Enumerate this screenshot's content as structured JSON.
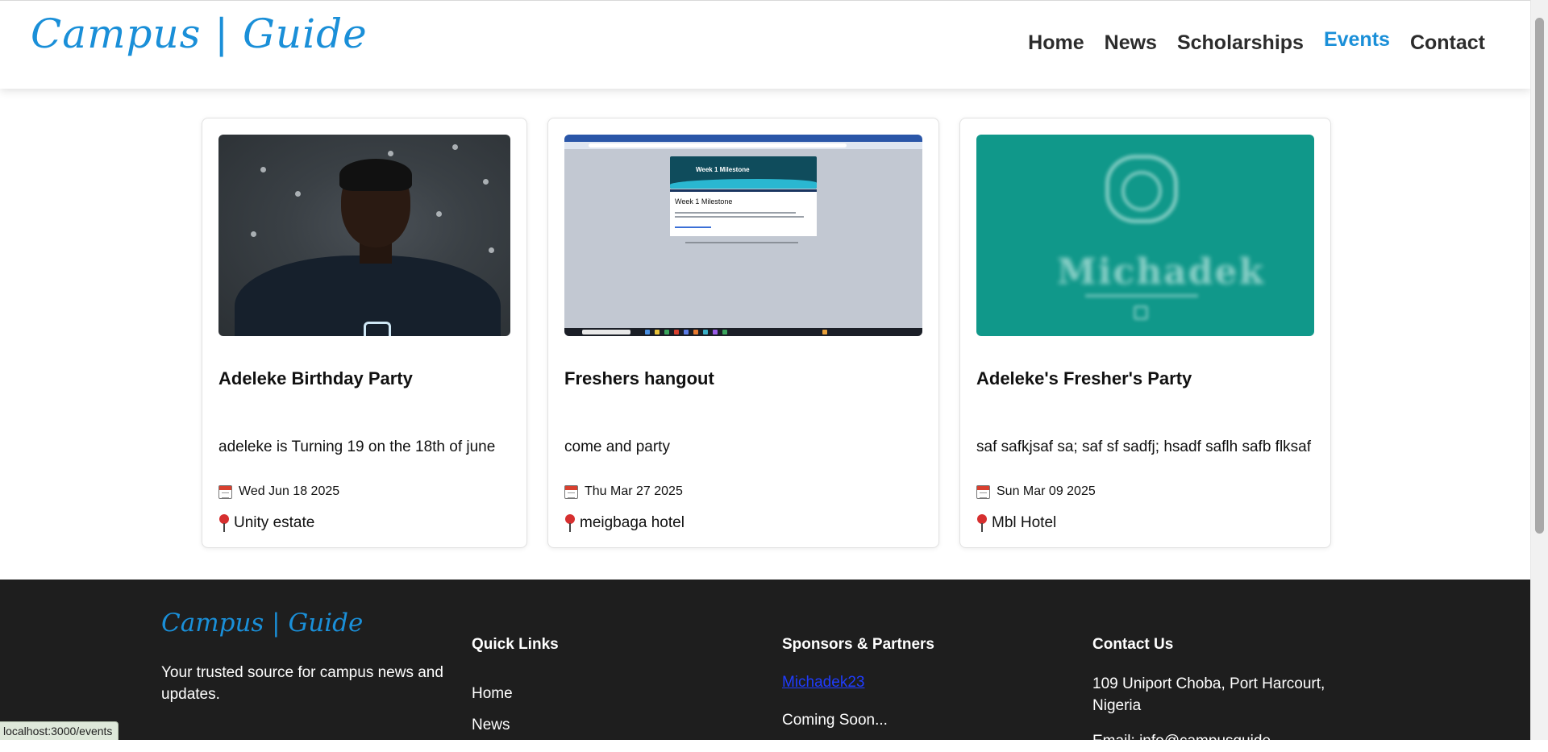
{
  "header": {
    "logo": "Campus | Guide",
    "nav": [
      "Home",
      "News",
      "Scholarships",
      "Events",
      "Contact"
    ],
    "active_nav": "Events"
  },
  "events": [
    {
      "title": "Adeleke Birthday Party",
      "description": "adeleke is Turning 19 on the 18th of june",
      "date": "Wed Jun 18 2025",
      "location": "Unity estate",
      "image": "person-photo"
    },
    {
      "title": "Freshers hangout",
      "description": "come and party",
      "date": "Thu Mar 27 2025",
      "location": "meigbaga hotel",
      "image": "browser-screenshot",
      "image_text": "Week 1 Milestone"
    },
    {
      "title": "Adeleke's Fresher's Party",
      "description": "saf safkjsaf sa; saf sf sadfj; hsadf saflh safb flksaf",
      "date": "Sun Mar 09 2025",
      "location": "Mbl Hotel",
      "image": "teal-logo"
    }
  ],
  "icons": {
    "date": "calendar-icon",
    "location": "pin-icon"
  },
  "footer": {
    "logo": "Campus | Guide",
    "tagline": "Your trusted source for campus news and updates.",
    "quick_links_heading": "Quick Links",
    "quick_links": [
      "Home",
      "News"
    ],
    "sponsors_heading": "Sponsors & Partners",
    "sponsor_link": "Michadek23",
    "sponsor_note": "Coming Soon...",
    "contact_heading": "Contact Us",
    "address": "109 Uniport Choba, Port Harcourt, Nigeria",
    "email_partial": "Email: info@campusguide..."
  },
  "status_url": "localhost:3000/events",
  "colors": {
    "accent": "#1a8fd8",
    "footer_bg": "#1e1e1e",
    "teal_image": "#10988a",
    "sponsor_link": "#1f3cff"
  }
}
